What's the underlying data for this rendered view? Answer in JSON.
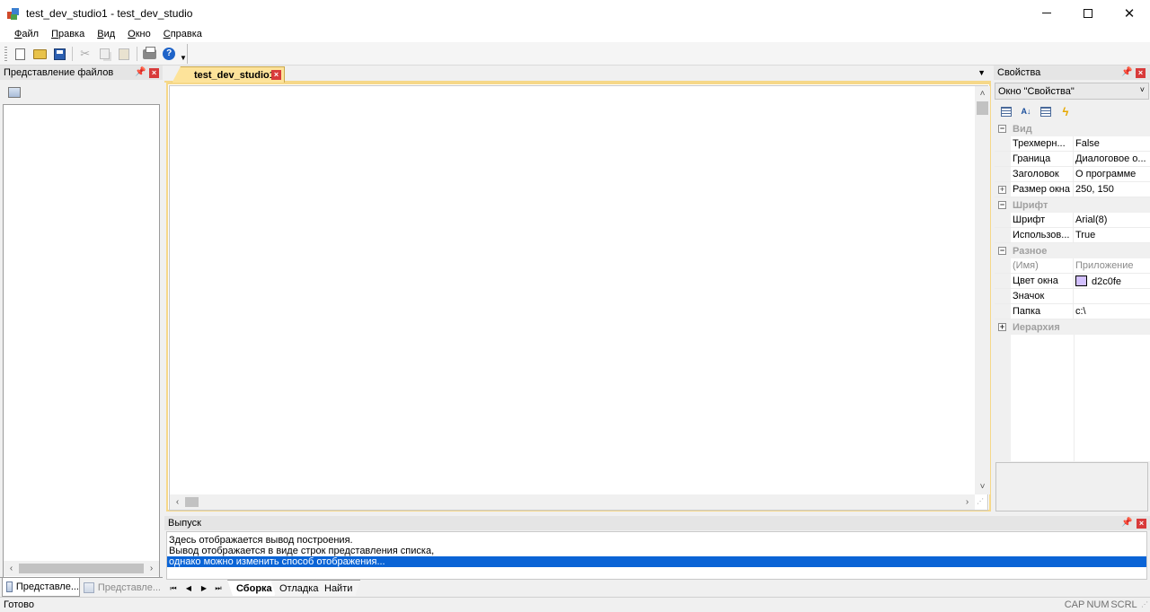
{
  "window": {
    "title": "test_dev_studio1 - test_dev_studio"
  },
  "menu": [
    {
      "label": "Файл",
      "key": "Ф",
      "rest": "айл"
    },
    {
      "label": "Правка",
      "key": "П",
      "rest": "равка"
    },
    {
      "label": "Вид",
      "key": "В",
      "rest": "ид"
    },
    {
      "label": "Окно",
      "key": "О",
      "rest": "кно"
    },
    {
      "label": "Справка",
      "key": "С",
      "rest": "правка"
    }
  ],
  "toolbar": {
    "help_glyph": "?"
  },
  "left_panel": {
    "title": "Представление файлов",
    "tabs": [
      "Представле...",
      "Представле..."
    ]
  },
  "document": {
    "tab_label": "test_dev_studio1"
  },
  "properties": {
    "title": "Свойства",
    "combo_value": "Окно \"Свойства\"",
    "rows": [
      {
        "kind": "cat",
        "expander": "−",
        "name": "Вид"
      },
      {
        "kind": "item",
        "name": "Трехмерн...",
        "value": "False"
      },
      {
        "kind": "item",
        "name": "Граница",
        "value": "Диалоговое о..."
      },
      {
        "kind": "item",
        "name": "Заголовок",
        "value": "О программе"
      },
      {
        "kind": "item",
        "expander": "+",
        "name": "Размер окна",
        "value": "250, 150"
      },
      {
        "kind": "cat",
        "expander": "−",
        "name": "Шрифт"
      },
      {
        "kind": "item",
        "name": "Шрифт",
        "value": "Arial(8)"
      },
      {
        "kind": "item",
        "name": "Использов...",
        "value": "True"
      },
      {
        "kind": "cat",
        "expander": "−",
        "name": "Разное"
      },
      {
        "kind": "item",
        "disabled": true,
        "name": "(Имя)",
        "value": "Приложение"
      },
      {
        "kind": "item",
        "name": "Цвет окна",
        "value": "d2c0fe",
        "swatch": "#d2c0fe"
      },
      {
        "kind": "item",
        "name": "Значок",
        "value": ""
      },
      {
        "kind": "item",
        "name": "Папка",
        "value": "c:\\"
      },
      {
        "kind": "cat",
        "expander": "+",
        "name": "Иерархия"
      }
    ]
  },
  "output": {
    "title": "Выпуск",
    "lines": [
      "Здесь отображается вывод построения.",
      "Вывод отображается в виде строк представления списка,",
      "однако можно изменить способ отображения..."
    ],
    "selected_index": 2,
    "tabs": [
      "Сборка",
      "Отладка",
      "Найти"
    ],
    "active_tab": 0
  },
  "status": {
    "text": "Готово",
    "indicators": [
      "CAP",
      "NUM",
      "SCRL"
    ]
  },
  "colors": {
    "doc_tab_active": "#fde39a",
    "selection": "#0a64d6",
    "close_button": "#d83a3a"
  }
}
